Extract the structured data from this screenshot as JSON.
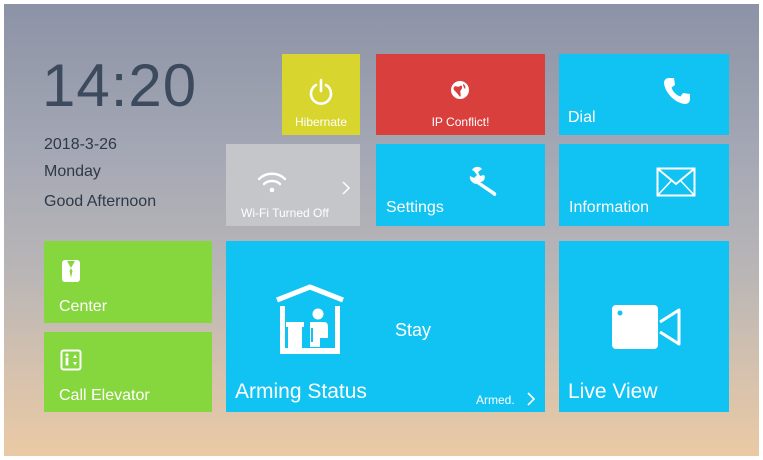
{
  "clock": {
    "time": "14:20",
    "date": "2018-3-26",
    "weekday": "Monday",
    "greeting": "Good Afternoon"
  },
  "tiles": {
    "hibernate": {
      "label": "Hibernate",
      "icon": "power-icon",
      "color": "#d8d52e"
    },
    "ip_conflict": {
      "label": "IP Conflict!",
      "icon": "globe-icon",
      "color": "#d93f3d"
    },
    "dial": {
      "label": "Dial",
      "icon": "phone-icon",
      "color": "#11c3f3"
    },
    "wifi": {
      "label": "Wi-Fi Turned Off",
      "icon": "wifi-icon",
      "color": "#c5c6c9"
    },
    "settings": {
      "label": "Settings",
      "icon": "wrench-icon",
      "color": "#11c3f3"
    },
    "information": {
      "label": "Information",
      "icon": "envelope-icon",
      "color": "#11c3f3"
    },
    "center": {
      "label": "Center",
      "icon": "user-icon",
      "color": "#86d63d"
    },
    "call_elevator": {
      "label": "Call Elevator",
      "icon": "elevator-icon",
      "color": "#86d63d"
    },
    "arming": {
      "label": "Arming Status",
      "mode": "Stay",
      "status": "Armed.",
      "icon": "stay-home-icon",
      "color": "#11c3f3"
    },
    "live_view": {
      "label": "Live View",
      "icon": "video-camera-icon",
      "color": "#11c3f3"
    }
  }
}
